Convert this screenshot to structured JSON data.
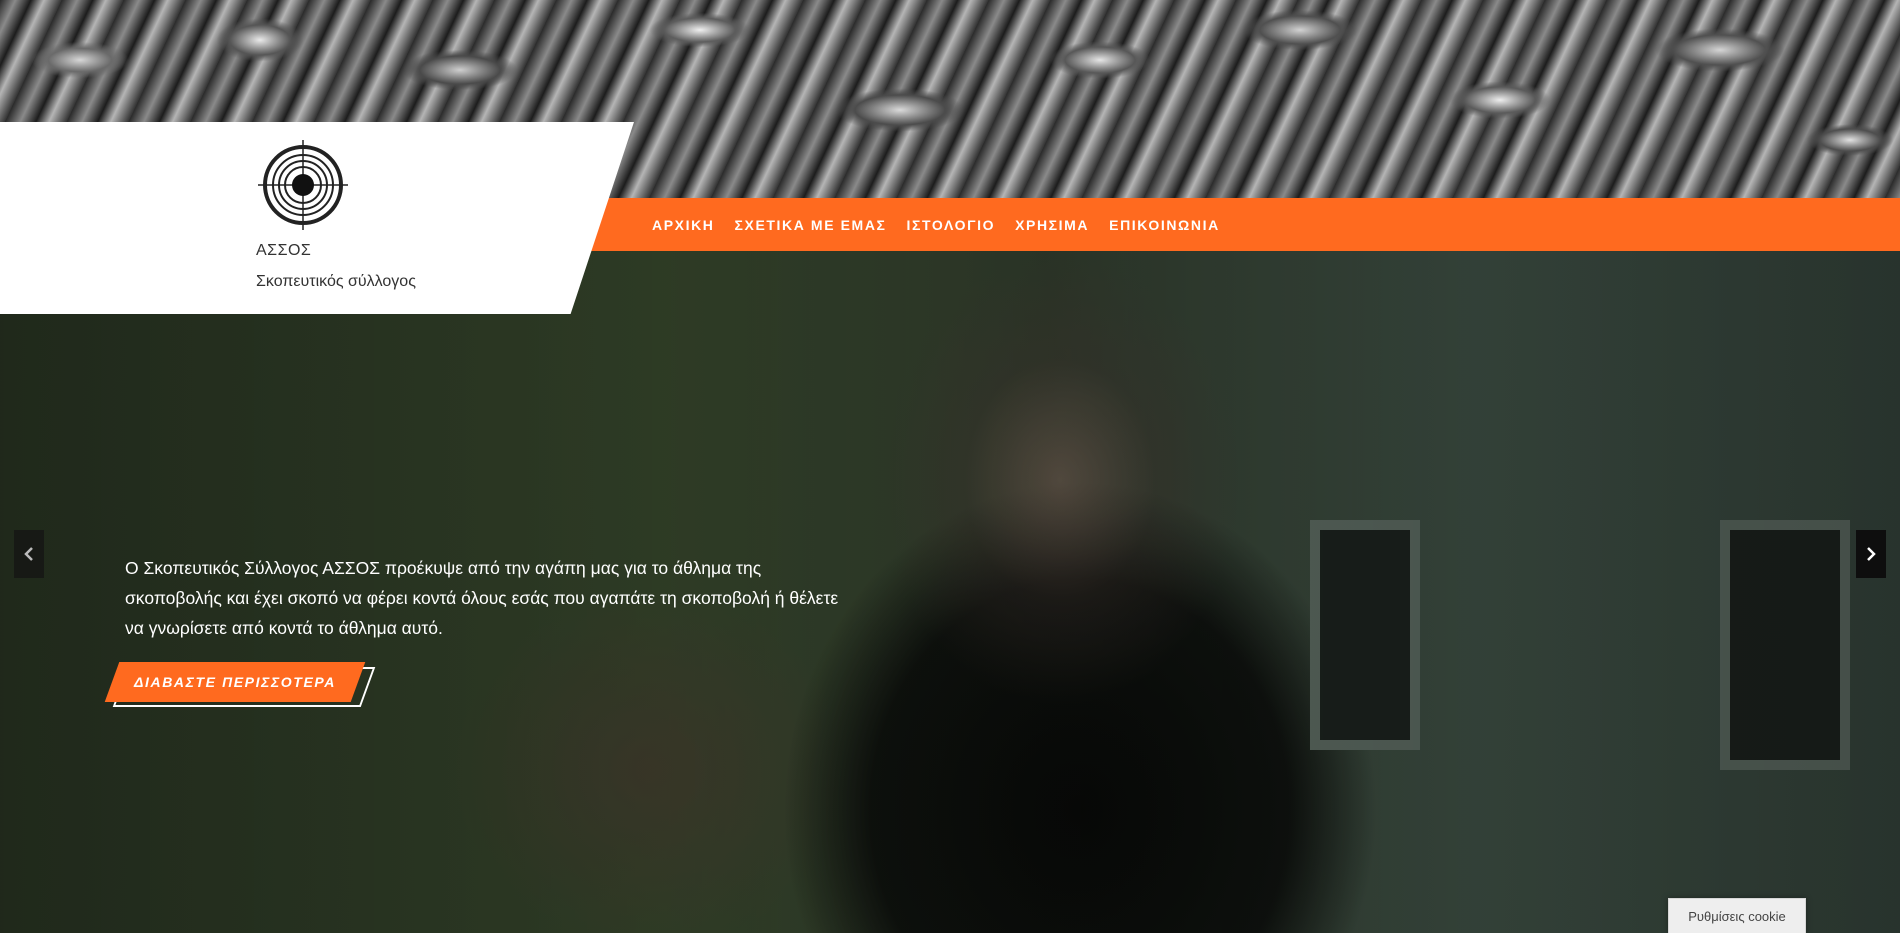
{
  "brand": {
    "name": "ΑΣΣΟΣ",
    "tagline": "Σκοπευτικός σύλλογος",
    "logo_icon": "target-icon"
  },
  "nav": {
    "items": [
      {
        "label": "ΑΡΧΙΚΗ"
      },
      {
        "label": "ΣΧΕΤΙΚΑ ΜΕ ΕΜΑΣ"
      },
      {
        "label": "ΙΣΤΟΛΟΓΙΟ"
      },
      {
        "label": "ΧΡΗΣΙΜΑ"
      },
      {
        "label": "ΕΠΙΚΟΙΝΩΝΙΑ"
      }
    ]
  },
  "hero": {
    "text": "Ο Σκοπευτικός Σύλλογος ΑΣΣΟΣ προέκυψε από την αγάπη μας για το άθλημα της σκοποβολής και έχει σκοπό να φέρει κοντά όλους εσάς που αγαπάτε τη σκοποβολή ή θέλετε να γνωρίσετε από κοντά το άθλημα αυτό.",
    "cta_label": "ΔΙΑΒΑΣΤΕ ΠΕΡΙΣΣΟΤΕΡΑ",
    "prev_icon": "chevron-left-icon",
    "next_icon": "chevron-right-icon"
  },
  "cookie": {
    "label": "Ρυθμίσεις cookie"
  },
  "colors": {
    "accent": "#ff6a1f",
    "white": "#ffffff",
    "dark": "#1e241c"
  }
}
